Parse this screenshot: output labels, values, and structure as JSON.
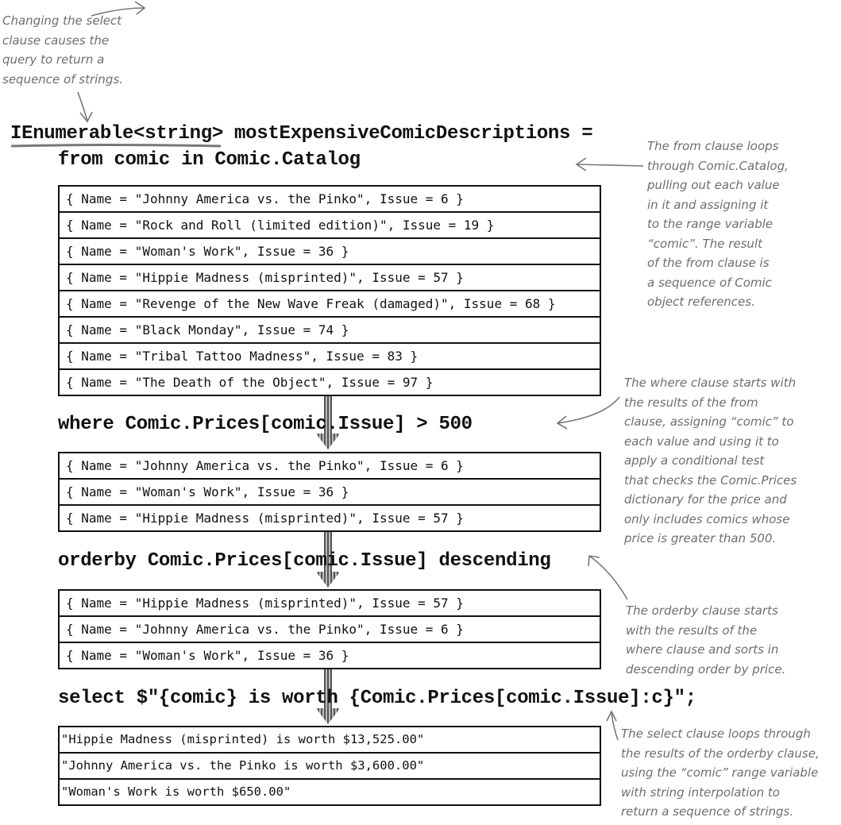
{
  "header": {
    "line1_type": "IEnumerable<string>",
    "line1_rest": " mostExpensiveComicDescriptions =",
    "from_clause": "from comic in Comic.Catalog"
  },
  "from_results": [
    "{ Name = \"Johnny America vs. the Pinko\", Issue = 6 }",
    "{ Name = \"Rock and Roll (limited edition)\", Issue = 19 }",
    "{ Name = \"Woman's Work\", Issue = 36 }",
    "{ Name = \"Hippie Madness (misprinted)\", Issue = 57 }",
    "{ Name = \"Revenge of the New Wave Freak (damaged)\", Issue = 68 }",
    "{ Name = \"Black Monday\", Issue = 74 }",
    "{ Name = \"Tribal Tattoo Madness\", Issue = 83 }",
    "{ Name = \"The Death of the Object\", Issue = 97 }"
  ],
  "where_clause": "where Comic.Prices[comic.Issue] > 500",
  "where_results": [
    "{ Name = \"Johnny America vs. the Pinko\", Issue = 6 }",
    "{ Name = \"Woman's Work\", Issue = 36 }",
    "{ Name = \"Hippie Madness (misprinted)\", Issue = 57 }"
  ],
  "orderby_clause": "orderby Comic.Prices[comic.Issue] descending",
  "orderby_results": [
    "{ Name = \"Hippie Madness (misprinted)\", Issue = 57 }",
    "{ Name = \"Johnny America vs. the Pinko\", Issue = 6 }",
    "{ Name = \"Woman's Work\", Issue = 36 }"
  ],
  "select_clause": "select $\"{comic} is worth {Comic.Prices[comic.Issue]:c}\";",
  "select_results": [
    "\"Hippie Madness (misprinted) is worth $13,525.00\"",
    "\"Johnny America vs. the Pinko is worth $3,600.00\"",
    "\"Woman's Work is worth $650.00\""
  ],
  "notes": {
    "select_change": "Changing the select\nclause causes the\nquery to return a\nsequence of strings.",
    "from": "The from clause loops\nthrough Comic.Catalog,\npulling out each value\nin it and assigning it\nto the range variable\n“comic”. The result\nof the from clause is\na sequence of Comic\nobject references.",
    "where": "The where clause starts with\nthe results of the from\nclause, assigning “comic” to\neach value and using it to\napply a conditional test\nthat checks the Comic.Prices\ndictionary for the price and\nonly includes comics whose\nprice is greater than 500.",
    "orderby": "The orderby clause starts\nwith the results of the\nwhere clause and sorts in\ndescending order by price.",
    "select": "The select clause loops through\nthe results of the orderby clause,\nusing the “comic” range variable\nwith string interpolation to\nreturn a sequence of strings."
  },
  "colors": {
    "code": "#111111",
    "annotation": "#6e6e6e",
    "flow_arrow": "#888888"
  }
}
